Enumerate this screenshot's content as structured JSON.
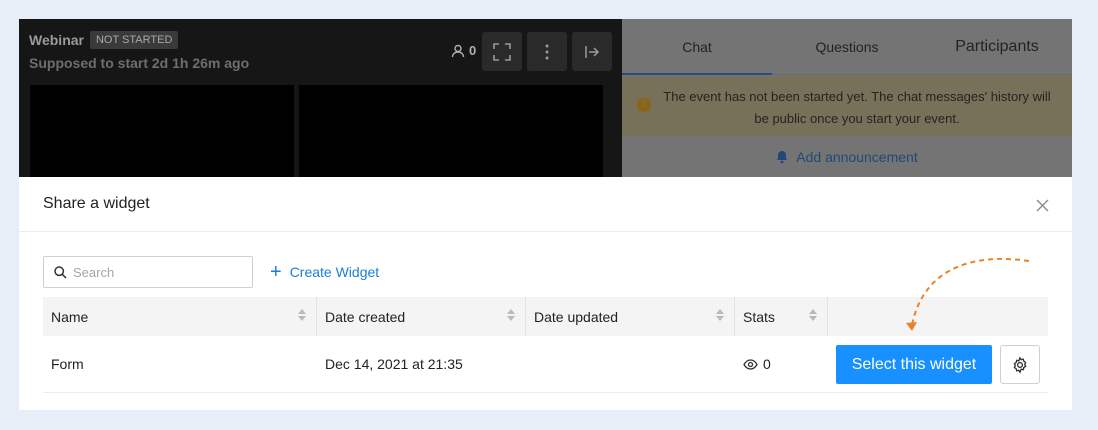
{
  "webinar": {
    "title": "Webinar",
    "status_badge": "NOT STARTED",
    "subtitle": "Supposed to start 2d 1h 26m ago",
    "attendee_count": "0"
  },
  "chat_panel": {
    "tabs": [
      {
        "label": "Chat",
        "active": true
      },
      {
        "label": "Questions",
        "active": false
      },
      {
        "label": "Participants",
        "active": false
      }
    ],
    "notice": "The event has not been started yet. The chat messages' history will be public once you start your event.",
    "announce_label": "Add announcement"
  },
  "modal": {
    "title": "Share a widget",
    "search_placeholder": "Search",
    "create_label": "Create Widget",
    "columns": [
      "Name",
      "Date created",
      "Date updated",
      "Stats"
    ],
    "rows": [
      {
        "name": "Form",
        "date_created": "Dec 14, 2021 at 21:35",
        "date_updated": "",
        "views": "0"
      }
    ],
    "select_label": "Select this widget"
  },
  "colors": {
    "primary": "#1890ff",
    "link": "#1a7ed6",
    "annotation_arrow": "#e8832a"
  }
}
